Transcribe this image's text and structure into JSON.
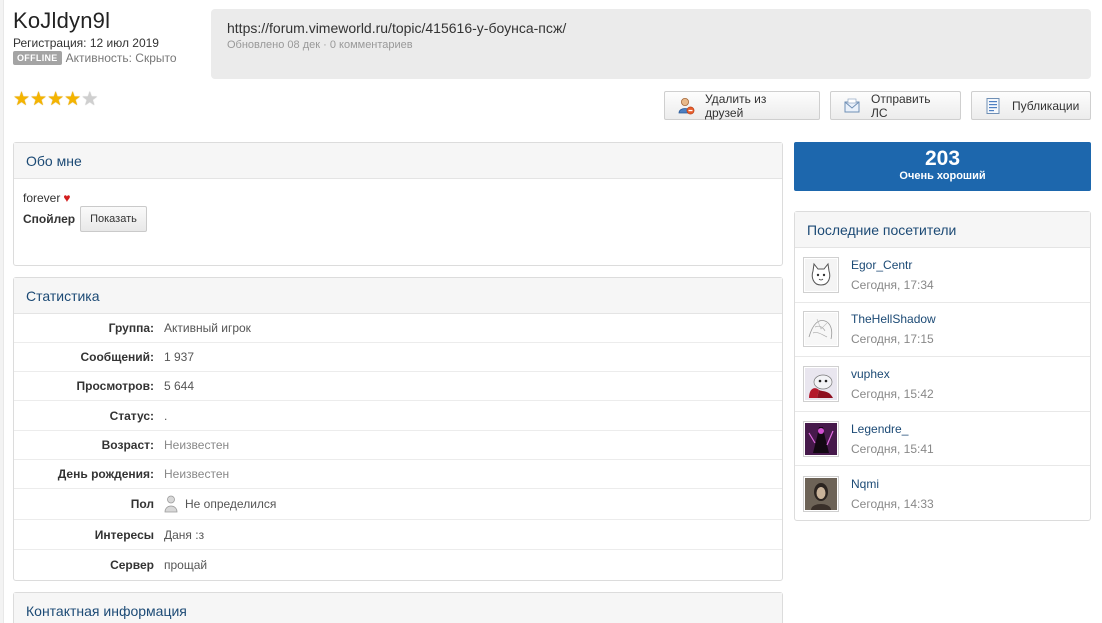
{
  "profile": {
    "username": "KoJldyn9l",
    "registration": "Регистрация: 12 июл 2019",
    "online_badge": "OFFLINE",
    "activity": "Активность: Скрыто",
    "stars_filled": 4,
    "stars_total": 5
  },
  "status_update": {
    "text": "https://forum.vimeworld.ru/topic/415616-у-боунса-псж/",
    "meta": "Обновлено 08 дек · 0 комментариев"
  },
  "actions": {
    "remove_friend": "Удалить из друзей",
    "send_pm": "Отправить ЛС",
    "publications": "Публикации"
  },
  "about": {
    "title": "Обо мне",
    "text": "forever",
    "heart": "♥",
    "spoiler_label": "Спойлер",
    "spoiler_button": "Показать"
  },
  "stats": {
    "title": "Статистика",
    "rows": [
      {
        "key": "Группа:",
        "value": "Активный игрок"
      },
      {
        "key": "Сообщений:",
        "value": "1 937"
      },
      {
        "key": "Просмотров:",
        "value": "5 644"
      },
      {
        "key": "Статус:",
        "value": "."
      },
      {
        "key": "Возраст:",
        "value": "Неизвестен"
      },
      {
        "key": "День рождения:",
        "value": "Неизвестен"
      },
      {
        "key": "Пол",
        "value": "Не определился"
      },
      {
        "key": "Интересы",
        "value": "Даня :з"
      },
      {
        "key": "Сервер",
        "value": "прощай"
      }
    ]
  },
  "contact": {
    "title": "Контактная информация"
  },
  "reputation": {
    "value": "203",
    "label": "Очень хороший"
  },
  "visitors": {
    "title": "Последние посетители",
    "items": [
      {
        "name": "Egor_Centr",
        "time": "Сегодня, 17:34"
      },
      {
        "name": "TheHellShadow",
        "time": "Сегодня, 17:15"
      },
      {
        "name": "vuphex",
        "time": "Сегодня, 15:42"
      },
      {
        "name": "Legendre_",
        "time": "Сегодня, 15:41"
      },
      {
        "name": "Nqmi",
        "time": "Сегодня, 14:33"
      }
    ]
  },
  "colors": {
    "link": "#1c4a75",
    "reputation_bg": "#1d67ad",
    "star": "#f4b400",
    "offline_badge": "#a4a4a4"
  }
}
